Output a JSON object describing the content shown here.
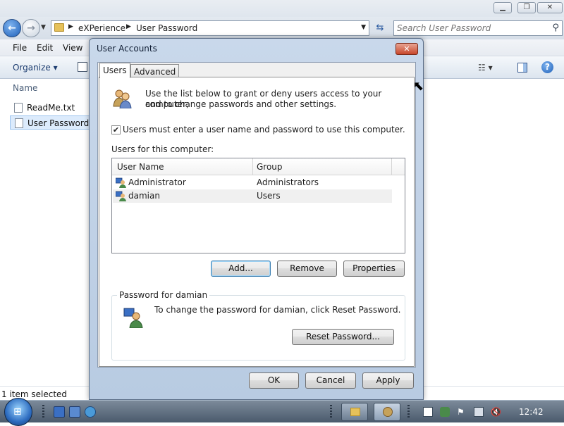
{
  "explorer": {
    "window_buttons": {
      "minimize": "▁",
      "maximize": "❐",
      "close": "✕"
    },
    "address": {
      "crumbs": [
        "eXPerience",
        "User Password"
      ]
    },
    "search": {
      "placeholder": "Search User Password"
    },
    "menu": [
      "File",
      "Edit",
      "View"
    ],
    "toolbar": {
      "organize": "Organize ▾",
      "views": "☷ ▾",
      "help": "?"
    },
    "column_header": "Name",
    "files": [
      {
        "name": "ReadMe.txt",
        "selected": false
      },
      {
        "name": "User Password.b",
        "selected": true
      }
    ],
    "status": "1 item selected"
  },
  "dialog": {
    "title": "User Accounts",
    "close": "✕",
    "tabs": [
      "Users",
      "Advanced"
    ],
    "active_tab": "Users",
    "intro_line1": "Use the list below to grant or deny users access to your computer,",
    "intro_line2": "and to change passwords and other settings.",
    "checkbox": {
      "label": "Users must enter a user name and password to use this computer.",
      "checked": true,
      "mark": "✔"
    },
    "users_label": "Users for this computer:",
    "list": {
      "columns": [
        "User Name",
        "Group"
      ],
      "rows": [
        {
          "user": "Administrator",
          "group": "Administrators"
        },
        {
          "user": "damian",
          "group": "Users"
        }
      ]
    },
    "buttons": {
      "add": "Add...",
      "remove": "Remove",
      "properties": "Properties"
    },
    "password_group": {
      "label": "Password for damian",
      "text": "To change the password for damian, click Reset Password.",
      "reset": "Reset Password..."
    },
    "footer": {
      "ok": "OK",
      "cancel": "Cancel",
      "apply": "Apply"
    }
  },
  "taskbar": {
    "clock": "12:42"
  }
}
